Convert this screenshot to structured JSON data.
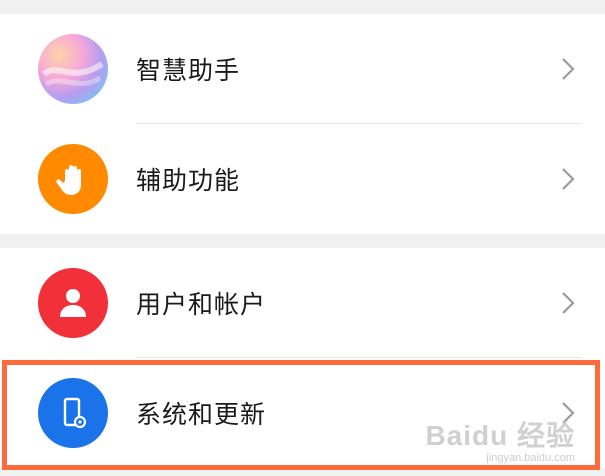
{
  "settings": {
    "items": [
      {
        "label": "智慧助手",
        "icon": "gradient-assistant-icon",
        "icon_color": "#c9a4e6"
      },
      {
        "label": "辅助功能",
        "icon": "hand-icon",
        "icon_color": "#ff8a00"
      },
      {
        "label": "用户和帐户",
        "icon": "user-icon",
        "icon_color": "#f1303a"
      },
      {
        "label": "系统和更新",
        "icon": "phone-settings-icon",
        "icon_color": "#1a73e8"
      }
    ],
    "chevron_icon": "chevron-right-icon"
  },
  "highlight": {
    "target": "系统和更新",
    "color": "#ff6a3d"
  },
  "watermark": {
    "brand": "Baidu 经验",
    "url": "jingyan.baidu.com"
  }
}
